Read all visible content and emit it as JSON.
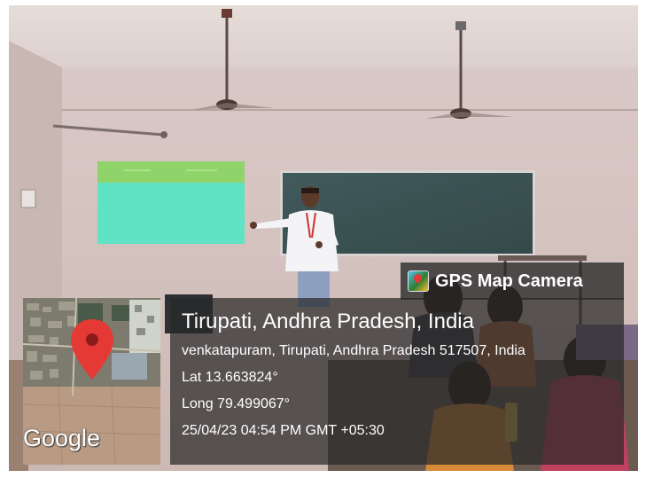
{
  "badge": {
    "icon": "map-pin-app-icon",
    "label": "GPS Map Camera"
  },
  "location": {
    "title": "Tirupati, Andhra Pradesh, India",
    "address": "venkatapuram, Tirupati, Andhra Pradesh 517507, India",
    "latitude": "Lat 13.663824°",
    "longitude": "Long 79.499067°",
    "timestamp": "25/04/23 04:54 PM GMT +05:30"
  },
  "map": {
    "pin_icon": "map-pin-icon",
    "pin_color": "#e53935",
    "attribution": "Google"
  },
  "colors": {
    "overlay": "#282828",
    "text": "#ffffff",
    "projection": "#5fe3c4",
    "projection_header": "#8fd46b",
    "chalkboard": "#3a4f50"
  }
}
